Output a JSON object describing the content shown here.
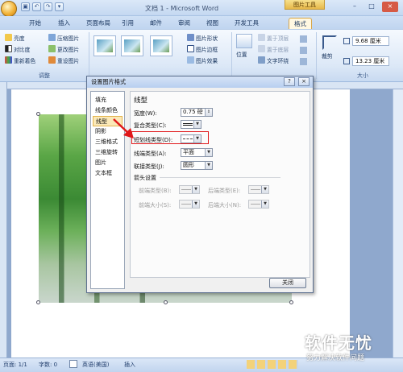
{
  "window": {
    "title": "文档 1 - Microsoft Word",
    "contextual_tool": "图片工具",
    "controls": [
      "–",
      "□",
      "×"
    ]
  },
  "tabs": [
    "开始",
    "插入",
    "页面布局",
    "引用",
    "邮件",
    "审阅",
    "视图",
    "开发工具",
    "格式"
  ],
  "active_tab": "格式",
  "ribbon": {
    "adjust": {
      "items": [
        "亮度",
        "压缩图片",
        "对比度",
        "更改图片",
        "重新着色",
        "重设图片"
      ],
      "label": "调整"
    },
    "picture_styles": {
      "items": [
        "图片形状",
        "图片边框",
        "图片效果"
      ]
    },
    "arrange": {
      "position": "位置",
      "items": [
        "置于顶层",
        "置于底层",
        "文字环绕"
      ]
    },
    "size": {
      "crop": "裁剪",
      "height_value": "9.68 厘米",
      "width_value": "13.23 厘米",
      "label": "大小"
    }
  },
  "dialog": {
    "title": "设置图片格式",
    "help": "?",
    "close": "×",
    "categories": [
      "填充",
      "线条颜色",
      "线型",
      "阴影",
      "三维格式",
      "三维旋转",
      "图片",
      "文本框"
    ],
    "selected_category": "线型",
    "panel": {
      "heading": "线型",
      "width_label": "宽度(W):",
      "width_value": "0.75 磅",
      "compound_label": "复合类型(C):",
      "dash_label": "短划线类型(D):",
      "cap_label": "线端类型(A):",
      "cap_value": "平面",
      "join_label": "联接类型(J):",
      "join_value": "圆形",
      "arrow_section": "箭头设置",
      "begin_type_label": "前端类型(B):",
      "end_type_label": "后端类型(E):",
      "begin_size_label": "前端大小(S):",
      "end_size_label": "后端大小(N):"
    },
    "close_button": "关闭"
  },
  "status": {
    "page": "页面: 1/1",
    "words": "字数: 0",
    "language": "英语(美国)",
    "mode": "插入"
  },
  "watermark": {
    "brand": "软件无忧",
    "slogan": "努力解决软件问题"
  }
}
